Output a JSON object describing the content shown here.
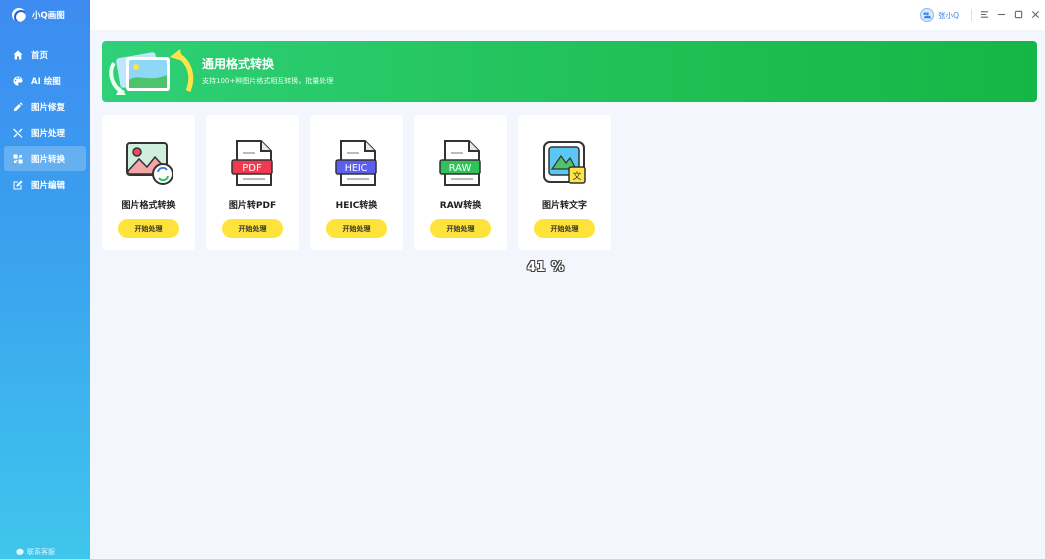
{
  "app": {
    "name": "小Q画图"
  },
  "sidebar": {
    "items": [
      {
        "label": "首页",
        "icon": "home-icon",
        "active": false
      },
      {
        "label": "AI 绘图",
        "icon": "palette-icon",
        "active": false
      },
      {
        "label": "图片修复",
        "icon": "repair-icon",
        "active": false
      },
      {
        "label": "图片处理",
        "icon": "tools-icon",
        "active": false
      },
      {
        "label": "图片转换",
        "icon": "convert-icon",
        "active": true
      },
      {
        "label": "图片编辑",
        "icon": "edit-icon",
        "active": false
      }
    ],
    "contact_label": "联系客服"
  },
  "titlebar": {
    "user_name": "张小Q"
  },
  "banner": {
    "title": "通用格式转换",
    "subtitle": "支持100+种图片格式相互转换，批量处理"
  },
  "cards": [
    {
      "title": "图片格式转换",
      "button": "开始处理",
      "icon": "image-format-icon"
    },
    {
      "title": "图片转PDF",
      "button": "开始处理",
      "icon": "pdf-file-icon",
      "badge": "PDF",
      "badge_color": "#ef3a50"
    },
    {
      "title": "HEIC转换",
      "button": "开始处理",
      "icon": "heic-file-icon",
      "badge": "HEIC",
      "badge_color": "#5a5ff0"
    },
    {
      "title": "RAW转换",
      "button": "开始处理",
      "icon": "raw-file-icon",
      "badge": "RAW",
      "badge_color": "#2fc25a"
    },
    {
      "title": "图片转文字",
      "button": "开始处理",
      "icon": "image-to-text-icon",
      "badge": "文"
    }
  ],
  "progress": {
    "text": "41 %"
  },
  "colors": {
    "accent": "#3b82e8",
    "banner": "#1fc055",
    "button": "#fde33a"
  }
}
